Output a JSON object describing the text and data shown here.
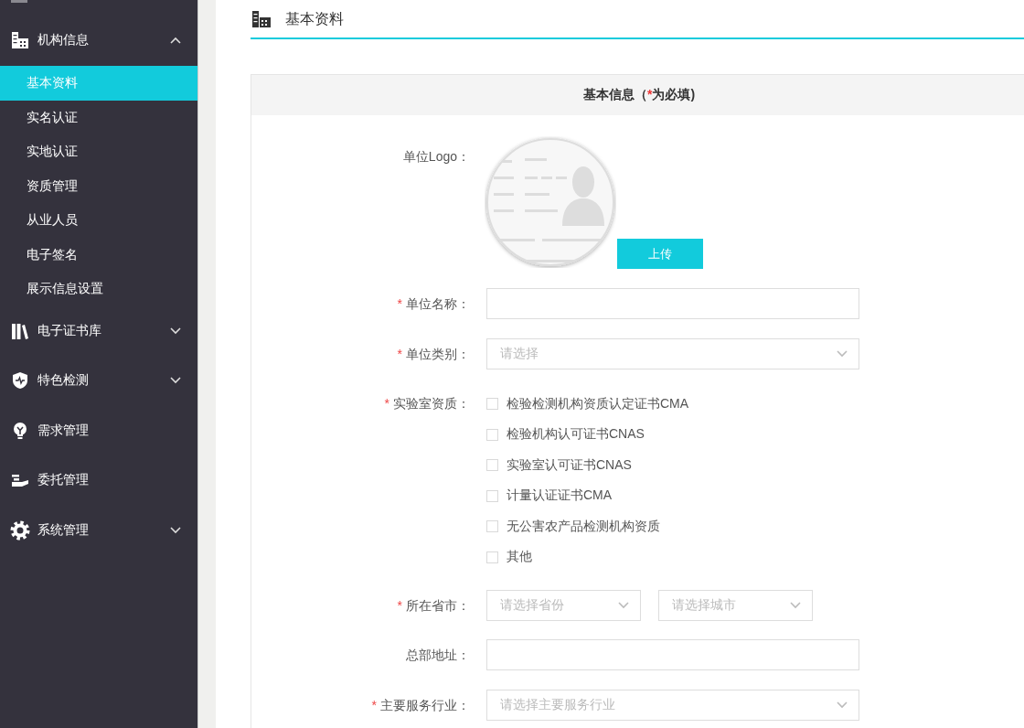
{
  "sidebar": {
    "groups": [
      {
        "label": "机构信息",
        "expanded": true,
        "children": [
          {
            "label": "基本资料",
            "selected": true
          },
          {
            "label": "实名认证",
            "selected": false
          },
          {
            "label": "实地认证",
            "selected": false
          },
          {
            "label": "资质管理",
            "selected": false
          },
          {
            "label": "从业人员",
            "selected": false
          },
          {
            "label": "电子签名",
            "selected": false
          },
          {
            "label": "展示信息设置",
            "selected": false
          }
        ]
      },
      {
        "label": "电子证书库",
        "expanded": false
      },
      {
        "label": "特色检测",
        "expanded": false
      },
      {
        "label": "需求管理"
      },
      {
        "label": "委托管理"
      },
      {
        "label": "系统管理",
        "expanded": false
      }
    ]
  },
  "page": {
    "title": "基本资料"
  },
  "card": {
    "title": "基本信息（",
    "title_mark": "*",
    "title_tail": "为必填)"
  },
  "form": {
    "rows": [
      {
        "kind": "logo",
        "label": "单位Logo：",
        "button": "上传"
      },
      {
        "kind": "text",
        "label": "单位名称：",
        "required_mark": "*"
      },
      {
        "kind": "select",
        "label": "单位类别：",
        "required_mark": "*",
        "placeholder": "请选择"
      },
      {
        "kind": "checkboxes",
        "label": "实验室资质：",
        "required_mark": "*",
        "options": [
          {
            "label": "检验检测机构资质认定证书CMA",
            "checked": false
          },
          {
            "label": "检验机构认可证书CNAS",
            "checked": false
          },
          {
            "label": "实验室认可证书CNAS",
            "checked": false
          },
          {
            "label": "计量认证证书CMA",
            "checked": false
          },
          {
            "label": "无公害农产品检测机构资质",
            "checked": false
          },
          {
            "label": "其他",
            "checked": false
          }
        ]
      },
      {
        "kind": "select_pair",
        "label": "所在省市：",
        "required_mark": "*",
        "selects": [
          {
            "placeholder": "请选择省份"
          },
          {
            "placeholder": "请选择城市"
          }
        ]
      },
      {
        "kind": "text",
        "label": "总部地址："
      },
      {
        "kind": "select",
        "label": "主要服务行业：",
        "required_mark": "*",
        "placeholder": "请选择主要服务行业"
      }
    ]
  }
}
